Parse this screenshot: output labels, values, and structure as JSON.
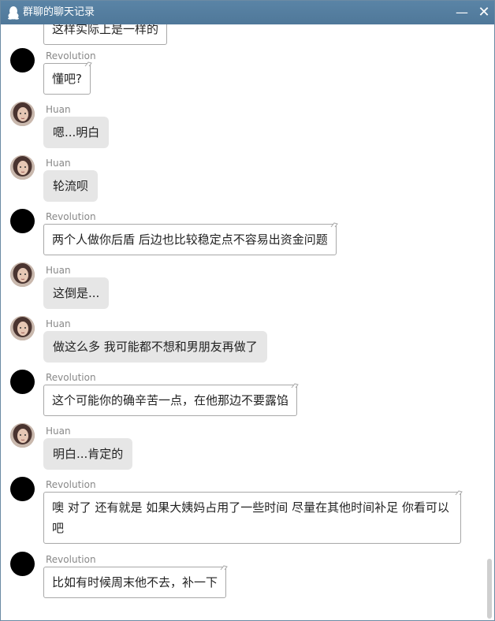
{
  "window": {
    "title": "群聊的聊天记录",
    "minimize_glyph": "—",
    "close_glyph": "✕"
  },
  "messages": [
    {
      "sender": "",
      "text": "这样实际上是一样的"
    },
    {
      "sender": "Revolution",
      "text": "懂吧?"
    },
    {
      "sender": "Huan",
      "text": "嗯...明白"
    },
    {
      "sender": "Huan",
      "text": "轮流呗"
    },
    {
      "sender": "Revolution",
      "text": "两个人做你后盾 后边也比较稳定点不容易出资金问题"
    },
    {
      "sender": "Huan",
      "text": "这倒是..."
    },
    {
      "sender": "Huan",
      "text": "做这么多 我可能都不想和男朋友再做了"
    },
    {
      "sender": "Revolution",
      "text": "这个可能你的确辛苦一点，在他那边不要露馅"
    },
    {
      "sender": "Huan",
      "text": "明白...肯定的"
    },
    {
      "sender": "Revolution",
      "text": "噢 对了 还有就是 如果大姨妈占用了一些时间 尽量在其他时间补足 你看可以吧"
    },
    {
      "sender": "Revolution",
      "text": "比如有时候周末他不去，补一下"
    }
  ],
  "icons": {
    "app_icon": "qq-penguin-icon",
    "minimize": "minimize-icon",
    "close": "close-icon"
  },
  "colors": {
    "titlebar": "#557d9f",
    "bubble_gray": "#e6e6e6",
    "name_text": "#888888"
  }
}
